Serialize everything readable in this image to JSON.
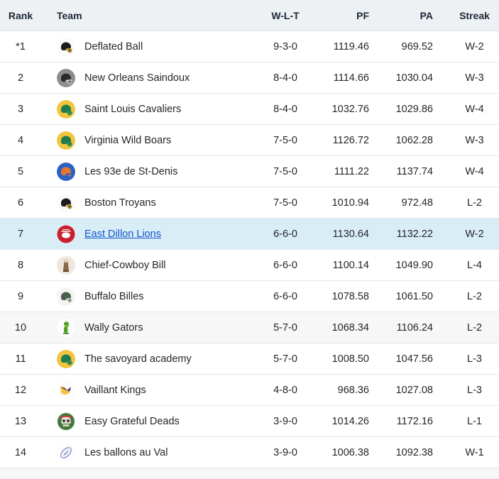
{
  "table": {
    "columns": [
      {
        "key": "rank",
        "label": "Rank",
        "align": "center"
      },
      {
        "key": "team",
        "label": "Team",
        "align": "left"
      },
      {
        "key": "wlt",
        "label": "W-L-T",
        "align": "center"
      },
      {
        "key": "pf",
        "label": "PF",
        "align": "right"
      },
      {
        "key": "pa",
        "label": "PA",
        "align": "right"
      },
      {
        "key": "streak",
        "label": "Streak",
        "align": "center"
      }
    ],
    "rows": [
      {
        "rank": "*1",
        "team": "Deflated Ball",
        "wlt": "9-3-0",
        "pf": "1119.46",
        "pa": "969.52",
        "streak": "W-2",
        "logo": "helmet-black-gold-icon",
        "style": "normal",
        "link": false
      },
      {
        "rank": "2",
        "team": "New Orleans Saindoux",
        "wlt": "8-4-0",
        "pf": "1114.66",
        "pa": "1030.04",
        "streak": "W-3",
        "logo": "helmet-gray-icon",
        "style": "normal",
        "link": false
      },
      {
        "rank": "3",
        "team": "Saint Louis Cavaliers",
        "wlt": "8-4-0",
        "pf": "1032.76",
        "pa": "1029.86",
        "streak": "W-4",
        "logo": "helmet-green-gold-icon",
        "style": "normal",
        "link": false
      },
      {
        "rank": "4",
        "team": "Virginia Wild Boars",
        "wlt": "7-5-0",
        "pf": "1126.72",
        "pa": "1062.28",
        "streak": "W-3",
        "logo": "helmet-green-gold-icon",
        "style": "normal",
        "link": false
      },
      {
        "rank": "5",
        "team": "Les 93e de St-Denis",
        "wlt": "7-5-0",
        "pf": "1111.22",
        "pa": "1137.74",
        "streak": "W-4",
        "logo": "helmet-blue-orange-icon",
        "style": "normal",
        "link": false
      },
      {
        "rank": "6",
        "team": "Boston Troyans",
        "wlt": "7-5-0",
        "pf": "1010.94",
        "pa": "972.48",
        "streak": "L-2",
        "logo": "helmet-black-gold-icon",
        "style": "normal",
        "link": false
      },
      {
        "rank": "7",
        "team": "East Dillon Lions",
        "wlt": "6-6-0",
        "pf": "1130.64",
        "pa": "1132.22",
        "streak": "W-2",
        "logo": "badge-red-icon",
        "style": "highlight",
        "link": true
      },
      {
        "rank": "8",
        "team": "Chief-Cowboy Bill",
        "wlt": "6-6-0",
        "pf": "1100.14",
        "pa": "1049.90",
        "streak": "L-4",
        "logo": "figure-tan-icon",
        "style": "normal",
        "link": false
      },
      {
        "rank": "9",
        "team": "Buffalo Billes",
        "wlt": "6-6-0",
        "pf": "1078.58",
        "pa": "1061.50",
        "streak": "L-2",
        "logo": "helmet-silver-icon",
        "style": "normal",
        "link": false
      },
      {
        "rank": "10",
        "team": "Wally Gators",
        "wlt": "5-7-0",
        "pf": "1068.34",
        "pa": "1106.24",
        "streak": "L-2",
        "logo": "gator-green-icon",
        "style": "alt",
        "link": false
      },
      {
        "rank": "11",
        "team": "The savoyard academy",
        "wlt": "5-7-0",
        "pf": "1008.50",
        "pa": "1047.56",
        "streak": "L-3",
        "logo": "helmet-green-gold-icon",
        "style": "normal",
        "link": false
      },
      {
        "rank": "12",
        "team": "Vaillant Kings",
        "wlt": "4-8-0",
        "pf": "968.36",
        "pa": "1027.08",
        "streak": "L-3",
        "logo": "viking-horn-icon",
        "style": "normal",
        "link": false
      },
      {
        "rank": "13",
        "team": "Easy Grateful Deads",
        "wlt": "3-9-0",
        "pf": "1014.26",
        "pa": "1172.16",
        "streak": "L-1",
        "logo": "skull-green-icon",
        "style": "normal",
        "link": false
      },
      {
        "rank": "14",
        "team": "Les ballons au Val",
        "wlt": "3-9-0",
        "pf": "1006.38",
        "pa": "1092.38",
        "streak": "W-1",
        "logo": "football-white-icon",
        "style": "normal",
        "link": false
      }
    ]
  },
  "colors": {
    "header_bg": "#eef1f4",
    "row_alt_bg": "#f7f7f7",
    "row_highlight_bg": "#d9edf7",
    "link": "#1155cc",
    "text": "#262626",
    "border": "#e6e6e6"
  }
}
